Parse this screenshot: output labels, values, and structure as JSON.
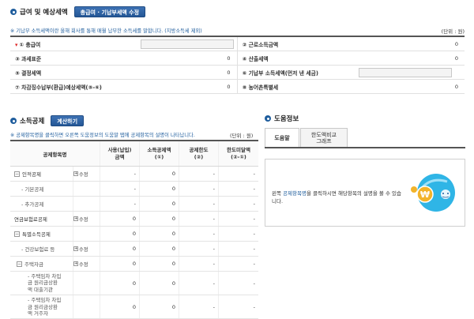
{
  "salary_section": {
    "title": "급여 및 예상세액",
    "edit_button": "총급여 · 기납부세액 수정",
    "note": "※ 기납부 소득세액이란 올해 회사를 통해 매월 납부한 소득세를 말합니다. (지방소득세 제외)",
    "unit": "(단위 : 원)",
    "rows": [
      {
        "left_label": "① 총급여",
        "left_value": "",
        "left_input": true,
        "left_required": true,
        "right_label": "② 근로소득금액",
        "right_value": "0"
      },
      {
        "left_label": "③ 과세표준",
        "left_value": "0",
        "right_label": "④ 산출세액",
        "right_value": "0"
      },
      {
        "left_label": "⑤ 결정세액",
        "left_value": "0",
        "right_label": "⑥ 기납부 소득세액(먼저 낸 세금)",
        "right_value": "",
        "right_input": true
      },
      {
        "left_label": "⑦ 차감징수납부(환급)예상세액(⑤-⑥)",
        "left_value": "0",
        "right_label": "⑧ 농어촌특별세",
        "right_value": "0"
      }
    ]
  },
  "deduction_section": {
    "title": "소득공제",
    "calc_button": "계산하기",
    "note": "※ 공제항목명을 클릭하면 오른쪽 도움정보의 도움말 탭에 공제항목의 설명이 나타납니다.",
    "unit": "(단위 : 원)",
    "headers": {
      "name": "공제항목명",
      "used": "사용(납입)\n금액",
      "deduct": "소득공제액\n(①)",
      "limit": "공제한도\n(②)",
      "excess": "한도미달액\n(②-①)"
    },
    "edit_label": "수정",
    "rows": [
      {
        "name": "인적공제",
        "toggle": "−",
        "edit": true,
        "used": "-",
        "deduct": "0",
        "limit": "-",
        "excess": "-"
      },
      {
        "name": "- 기본공제",
        "sub": 1,
        "used": "-",
        "deduct": "0",
        "limit": "-",
        "excess": "-"
      },
      {
        "name": "- 추가공제",
        "sub": 1,
        "used": "-",
        "deduct": "0",
        "limit": "-",
        "excess": "-"
      },
      {
        "name": "연금보험료공제",
        "edit": true,
        "used": "0",
        "deduct": "0",
        "limit": "-",
        "excess": "-"
      },
      {
        "name": "특별소득공제",
        "toggle": "−",
        "used": "0",
        "deduct": "0",
        "limit": "-",
        "excess": "-"
      },
      {
        "name": "- 건강보험료 등",
        "sub": 1,
        "edit": true,
        "used": "0",
        "deduct": "0",
        "limit": "-",
        "excess": "-"
      },
      {
        "name": "주택자금",
        "sub": 1,
        "toggle": "−",
        "edit": true,
        "used": "0",
        "deduct": "0",
        "limit": "-",
        "excess": "-"
      },
      {
        "name": "- 주택임차 차입\n금 원리금상환\n액 대출기관",
        "sub": 2,
        "used": "0",
        "deduct": "0",
        "limit": "-",
        "excess": "-"
      },
      {
        "name": "- 주택임차 차입\n금 원리금상환\n액 거주자",
        "sub": 2,
        "used": "0",
        "deduct": "0",
        "limit": "-",
        "excess": "-"
      }
    ]
  },
  "help_section": {
    "title": "도움정보",
    "tabs": [
      "도움말",
      "한도액비교\n그래프"
    ],
    "text_highlight": "공제항목명",
    "text_before": "왼쪽 ",
    "text_after": "을 클릭하시면 해당항목의 설명을 볼 수 있습니다.",
    "illustration": "help-coin-globe-icon",
    "won_symbol": "₩"
  },
  "colors": {
    "accent": "#1f5d9d",
    "button": "#2d62a6",
    "illustration": "#2fb5e6"
  }
}
